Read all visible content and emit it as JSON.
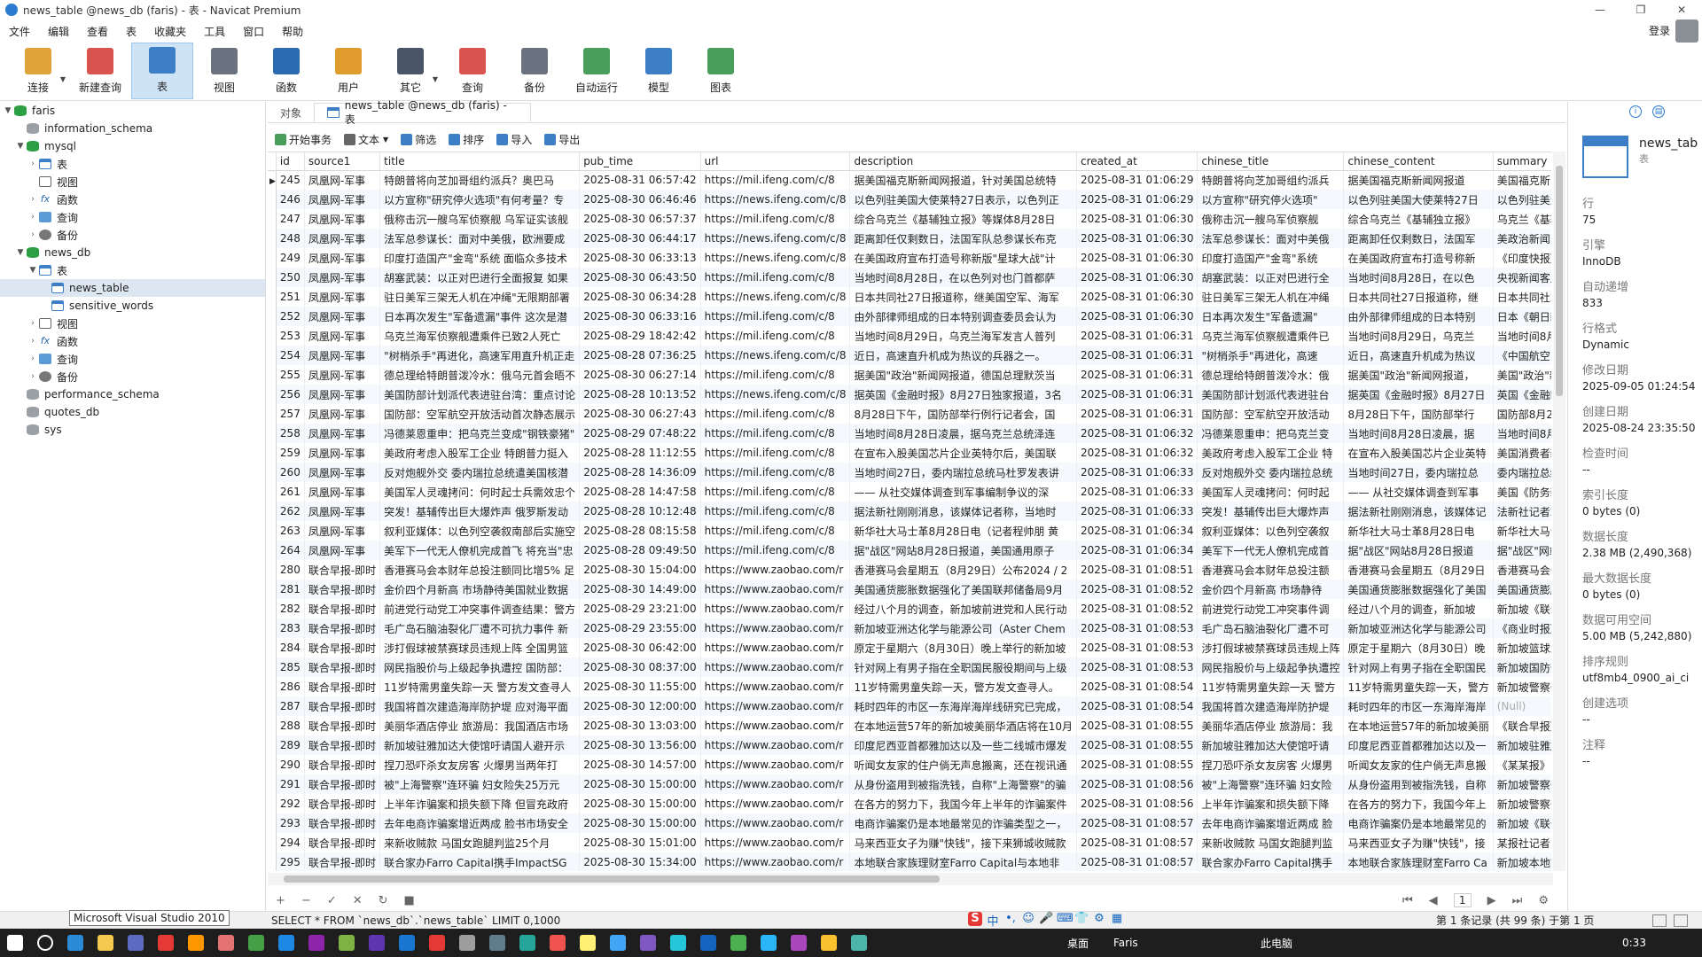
{
  "window": {
    "title": "news_table @news_db (faris) - 表 - Navicat Premium",
    "min": "—",
    "max": "❐",
    "close": "✕"
  },
  "menu": [
    "文件",
    "编辑",
    "查看",
    "表",
    "收藏夹",
    "工具",
    "窗口",
    "帮助"
  ],
  "login": "登录",
  "toolbar": [
    {
      "label": "连接",
      "color": "#e0a33a",
      "dd": true
    },
    {
      "label": "新建查询",
      "color": "#d9534f"
    },
    {
      "label": "表",
      "color": "#3c7fc6",
      "active": true
    },
    {
      "label": "视图",
      "color": "#6b7280"
    },
    {
      "label": "函数",
      "color": "#2b6cb0"
    },
    {
      "label": "用户",
      "color": "#e09b2d"
    },
    {
      "label": "其它",
      "color": "#4a5568",
      "dd": true
    },
    {
      "label": "查询",
      "color": "#d9534f"
    },
    {
      "label": "备份",
      "color": "#6b7280"
    },
    {
      "label": "自动运行",
      "color": "#4a9e5c"
    },
    {
      "label": "模型",
      "color": "#3c7fc6"
    },
    {
      "label": "图表",
      "color": "#4a9e5c"
    }
  ],
  "tree": [
    {
      "label": "faris",
      "level": 0,
      "caret": "▼",
      "icon": "db"
    },
    {
      "label": "information_schema",
      "level": 1,
      "caret": "",
      "icon": "dbg"
    },
    {
      "label": "mysql",
      "level": 1,
      "caret": "▼",
      "icon": "db"
    },
    {
      "label": "表",
      "level": 2,
      "caret": "›",
      "icon": "tbl"
    },
    {
      "label": "视图",
      "level": 2,
      "caret": "",
      "icon": "view"
    },
    {
      "label": "函数",
      "level": 2,
      "caret": "›",
      "icon": "fx"
    },
    {
      "label": "查询",
      "level": 2,
      "caret": "›",
      "icon": "q"
    },
    {
      "label": "备份",
      "level": 2,
      "caret": "›",
      "icon": "bk"
    },
    {
      "label": "news_db",
      "level": 1,
      "caret": "▼",
      "icon": "db"
    },
    {
      "label": "表",
      "level": 2,
      "caret": "▼",
      "icon": "tbl"
    },
    {
      "label": "news_table",
      "level": 3,
      "caret": "",
      "icon": "tbl",
      "sel": true
    },
    {
      "label": "sensitive_words",
      "level": 3,
      "caret": "",
      "icon": "tbl"
    },
    {
      "label": "视图",
      "level": 2,
      "caret": "›",
      "icon": "view"
    },
    {
      "label": "函数",
      "level": 2,
      "caret": "›",
      "icon": "fx"
    },
    {
      "label": "查询",
      "level": 2,
      "caret": "›",
      "icon": "q"
    },
    {
      "label": "备份",
      "level": 2,
      "caret": "›",
      "icon": "bk"
    },
    {
      "label": "performance_schema",
      "level": 1,
      "caret": "",
      "icon": "dbg"
    },
    {
      "label": "quotes_db",
      "level": 1,
      "caret": "",
      "icon": "dbg"
    },
    {
      "label": "sys",
      "level": 1,
      "caret": "",
      "icon": "dbg"
    }
  ],
  "tabs": {
    "objects": "对象",
    "active": "news_table @news_db (faris) - 表"
  },
  "subtoolbar": [
    {
      "label": "开始事务",
      "dd": false
    },
    {
      "label": "文本",
      "dd": true
    },
    {
      "label": "筛选",
      "dd": false
    },
    {
      "label": "排序",
      "dd": false
    },
    {
      "label": "导入",
      "dd": false
    },
    {
      "label": "导出",
      "dd": false
    }
  ],
  "columns": [
    "id",
    "source1",
    "title",
    "pub_time",
    "url",
    "description",
    "created_at",
    "chinese_title",
    "chinese_content",
    "summary"
  ],
  "rows": [
    [
      "245",
      "凤凰网-军事",
      "特朗普将向芝加哥组约派兵？奥巴马",
      "2025-08-31 06:57:42",
      "https://mil.ifeng.com/c/8",
      "据美国福克斯新闻网报道，针对美国总统特",
      "2025-08-31 01:06:29",
      "特朗普将向芝加哥组约派兵",
      "据美国福克斯新闻网报道",
      "美国福克斯"
    ],
    [
      "246",
      "凤凰网-军事",
      "以方宣称\"研究停火选项\"有何考量？专",
      "2025-08-30 06:46:46",
      "https://news.ifeng.com/c/8",
      "以色列驻美国大使莱特27日表示，以色列正",
      "2025-08-31 01:06:29",
      "以方宣称\"研究停火选项\"",
      "以色列驻美国大使莱特27日",
      "以色列驻美大"
    ],
    [
      "247",
      "凤凰网-军事",
      "俄称击沉一艘乌军侦察舰 乌军证实该舰",
      "2025-08-30 06:57:37",
      "https://mil.ifeng.com/c/8",
      "综合乌克兰《基辅独立报》等媒体8月28日",
      "2025-08-31 01:06:30",
      "俄称击沉一艘乌军侦察舰",
      "综合乌克兰《基辅独立报》",
      "乌克兰《基辅"
    ],
    [
      "248",
      "凤凰网-军事",
      "法军总参谋长：面对中美俄，欧洲要成",
      "2025-08-30 06:44:17",
      "https://news.ifeng.com/c/8",
      "距离卸任仅剩数日，法国军队总参谋长布克",
      "2025-08-31 01:06:30",
      "法军总参谋长：面对中美俄",
      "距离卸任仅剩数日，法国军",
      "美政治新闻"
    ],
    [
      "249",
      "凤凰网-军事",
      "印度打造国产\"金弯\"系统 面临众多技术",
      "2025-08-30 06:33:13",
      "https://news.ifeng.com/c/8",
      "在美国政府宣布打造号称新版\"星球大战\"计",
      "2025-08-31 01:06:30",
      "印度打造国产\"金弯\"系统",
      "在美国政府宣布打造号称新",
      "《印度快报》"
    ],
    [
      "250",
      "凤凰网-军事",
      "胡塞武装：以正对巴进行全面报复 如果",
      "2025-08-30 06:43:50",
      "https://mil.ifeng.com/c/8",
      "当地时间8月28日，在以色列对也门首都萨",
      "2025-08-31 01:06:30",
      "胡塞武装：以正对巴进行全",
      "当地时间8月28日，在以色",
      "央视新闻客户"
    ],
    [
      "251",
      "凤凰网-军事",
      "驻日美军三架无人机在冲绳\"无限期部署",
      "2025-08-30 06:34:28",
      "https://news.ifeng.com/c/8",
      "日本共同社27日报道称，继美国空军、海军",
      "2025-08-31 01:06:30",
      "驻日美军三架无人机在冲绳",
      "日本共同社27日报道称，继",
      "日本共同社27"
    ],
    [
      "252",
      "凤凰网-军事",
      "日本再次发生\"军备遗漏\"事件 这次是潜",
      "2025-08-30 06:33:16",
      "https://mil.ifeng.com/c/8",
      "由外部律师组成的日本特别调查委员会认为",
      "2025-08-31 01:06:30",
      "日本再次发生\"军备遗漏\"",
      "由外部律师组成的日本特别",
      "日本《朝日新"
    ],
    [
      "253",
      "凤凰网-军事",
      "乌克兰海军侦察舰遭乘件已致2人死亡",
      "2025-08-29 18:42:42",
      "https://mil.ifeng.com/c/8",
      "当地时间8月29日，乌克兰海军发言人普列",
      "2025-08-31 01:06:31",
      "乌克兰海军侦察舰遭乘件已",
      "当地时间8月29日，乌克兰",
      "当地时间8月2"
    ],
    [
      "254",
      "凤凰网-军事",
      "\"树梢杀手\"再进化，高速军用直升机正走",
      "2025-08-28 07:36:25",
      "https://news.ifeng.com/c/8",
      "近日，高速直升机成为热议的兵器之一。",
      "2025-08-31 01:06:31",
      "\"树梢杀手\"再进化，高速",
      "近日，高速直升机成为热议",
      "《中国航空"
    ],
    [
      "255",
      "凤凰网-军事",
      "德总理给特朗普泼冷水：俄乌元首会晤不",
      "2025-08-30 06:27:14",
      "https://mil.ifeng.com/c/8",
      "据美国\"政治\"新闻网报道，德国总理默茨当",
      "2025-08-31 01:06:31",
      "德总理给特朗普泼冷水：俄",
      "据美国\"政治\"新闻网报道，",
      "美国\"政治\"新"
    ],
    [
      "256",
      "凤凰网-军事",
      "美国防部计划派代表进驻台湾：重点讨论",
      "2025-08-28 10:13:52",
      "https://news.ifeng.com/c/8",
      "据英国《金融时报》8月27日独家报道，3名",
      "2025-08-31 01:06:31",
      "美国防部计划派代表进驻台",
      "据英国《金融时报》8月27日",
      "英国《金融时"
    ],
    [
      "257",
      "凤凰网-军事",
      "国防部：空军航空开放活动首次静态展示",
      "2025-08-30 06:27:43",
      "https://mil.ifeng.com/c/8",
      "8月28日下午，国防部举行例行记者会，国",
      "2025-08-31 01:06:31",
      "国防部：空军航空开放活动",
      "8月28日下午，国防部举行",
      "国防部8月2"
    ],
    [
      "258",
      "凤凰网-军事",
      "冯德莱恩重申：把乌克兰变成\"钢铁豪猪\"",
      "2025-08-29 07:48:22",
      "https://mil.ifeng.com/c/8",
      "当地时间8月28日凌晨，据乌克兰总统泽连",
      "2025-08-31 01:06:32",
      "冯德莱恩重申：把乌克兰变",
      "当地时间8月28日凌晨，据",
      "当地时间8月2"
    ],
    [
      "259",
      "凤凰网-军事",
      "美政府考虑入股军工企业 特朗普力挺入",
      "2025-08-28 11:12:55",
      "https://mil.ifeng.com/c/8",
      "在宣布入股美国芯片企业英特尔后，美国联",
      "2025-08-31 01:06:32",
      "美政府考虑入股军工企业 特",
      "在宣布入股美国芯片企业英特",
      "美国消费者新"
    ],
    [
      "260",
      "凤凰网-军事",
      "反对炮舰外交 委内瑞拉总统遣美国核潜",
      "2025-08-28 14:36:09",
      "https://mil.ifeng.com/c/8",
      "当地时间27日，委内瑞拉总统马杜罗发表讲",
      "2025-08-31 01:06:33",
      "反对炮舰外交 委内瑞拉总统",
      "当地时间27日，委内瑞拉总",
      "委内瑞拉总统"
    ],
    [
      "261",
      "凤凰网-军事",
      "美国军人灵魂拷问：何时起士兵需效忠个",
      "2025-08-28 14:47:58",
      "https://mil.ifeng.com/c/8",
      "—— 从社交媒体调查到军事编制争议的深",
      "2025-08-31 01:06:33",
      "美国军人灵魂拷问：何时起",
      "—— 从社交媒体调查到军事",
      "美国《防务新"
    ],
    [
      "262",
      "凤凰网-军事",
      "突发！基辅传出巨大爆炸声 俄罗斯发动",
      "2025-08-28 10:12:48",
      "https://mil.ifeng.com/c/8",
      "据法新社刚刚消息，该媒体记者称，当地时",
      "2025-08-31 01:06:33",
      "突发！基辅传出巨大爆炸声",
      "据法新社刚刚消息，该媒体记",
      "法新社记者28"
    ],
    [
      "263",
      "凤凰网-军事",
      "叙利亚媒体：以色列空袭叙南部后实施空",
      "2025-08-28 08:15:58",
      "https://mil.ifeng.com/c/8",
      "新华社大马士革8月28日电（记者程帅朋 黄",
      "2025-08-31 01:06:34",
      "叙利亚媒体：以色列空袭叙",
      "新华社大马士革8月28日电",
      "新华社大马士"
    ],
    [
      "264",
      "凤凰网-军事",
      "美军下一代无人僚机完成首飞 将充当\"忠",
      "2025-08-28 09:49:50",
      "https://mil.ifeng.com/c/8",
      "据\"战区\"网站8月28日报道，美国通用原子",
      "2025-08-31 01:06:34",
      "美军下一代无人僚机完成首",
      "据\"战区\"网站8月28日报道",
      "据\"战区\"网站"
    ],
    [
      "280",
      "联合早报-即时",
      "香港赛马会本财年总投注额同比增5% 足",
      "2025-08-30 15:04:00",
      "https://www.zaobao.com/r",
      "香港赛马会星期五（8月29日）公布2024 / 2",
      "2025-08-31 01:08:51",
      "香港赛马会本财年总投注额",
      "香港赛马会星期五（8月29日",
      "香港赛马会于"
    ],
    [
      "281",
      "联合早报-即时",
      "金价四个月新高 市场静待美国就业数据",
      "2025-08-30 14:49:00",
      "https://www.zaobao.com/r",
      "美国通货膨胀数据强化了美国联邦储备局9月",
      "2025-08-31 01:08:52",
      "金价四个月新高 市场静待",
      "美国通货膨胀数据强化了美国",
      "美国通货膨胀"
    ],
    [
      "282",
      "联合早报-即时",
      "前进党行动党工冲突事件调查结果：警方",
      "2025-08-29 23:21:00",
      "https://www.zaobao.com/r",
      "经过八个月的调查，新加坡前进党和人民行动",
      "2025-08-31 01:08:52",
      "前进党行动党工冲突事件调",
      "经过八个月的调查，新加坡",
      "新加坡《联合"
    ],
    [
      "283",
      "联合早报-即时",
      "毛广岛石脑油裂化厂遭不可抗力事件 新",
      "2025-08-29 23:55:00",
      "https://www.zaobao.com/r",
      "新加坡亚洲达化学与能源公司（Aster Chem",
      "2025-08-31 01:08:53",
      "毛广岛石脑油裂化厂遭不可",
      "新加坡亚洲达化学与能源公司",
      "《商业时报》"
    ],
    [
      "284",
      "联合早报-即时",
      "涉打假球被禁赛球员违规上阵 全国男篮",
      "2025-08-30 06:42:00",
      "https://www.zaobao.com/r",
      "原定于星期六（8月30日）晚上举行的新加坡",
      "2025-08-31 01:08:53",
      "涉打假球被禁赛球员违规上阵",
      "原定于星期六（8月30日）晚",
      "新加坡篮球总"
    ],
    [
      "285",
      "联合早报-即时",
      "网民指股价与上级起争执遭控 国防部：",
      "2025-08-30 08:37:00",
      "https://www.zaobao.com/r",
      "针对网上有男子指在全职国民服役期间与上级",
      "2025-08-31 01:08:53",
      "网民指股价与上级起争执遭控",
      "针对网上有男子指在全职国民",
      "新加坡国防部"
    ],
    [
      "286",
      "联合早报-即时",
      "11岁特需男童失踪一天 警方发文查寻人",
      "2025-08-30 11:55:00",
      "https://www.zaobao.com/r",
      "11岁特需男童失踪一天，警方发文查寻人。",
      "2025-08-31 01:08:54",
      "11岁特需男童失踪一天 警方",
      "11岁特需男童失踪一天，警方",
      "新加坡警察部"
    ],
    [
      "287",
      "联合早报-即时",
      "我国将首次建造海岸防护堤 应对海平面",
      "2025-08-30 12:00:00",
      "https://www.zaobao.com/r",
      "耗时四年的市区一东海岸海岸线研究已完成，",
      "2025-08-31 01:08:54",
      "我国将首次建造海岸防护堤",
      "耗时四年的市区一东海岸海岸",
      "(Null)"
    ],
    [
      "288",
      "联合早报-即时",
      "美丽华酒店停业 旅游局：我国酒店市场",
      "2025-08-30 13:03:00",
      "https://www.zaobao.com/r",
      "在本地运营57年的新加坡美丽华酒店将在10月",
      "2025-08-31 01:08:55",
      "美丽华酒店停业 旅游局：我",
      "在本地运营57年的新加坡美丽",
      "《联合早报》"
    ],
    [
      "289",
      "联合早报-即时",
      "新加坡驻雅加达大使馆吁请国人避开示",
      "2025-08-30 13:56:00",
      "https://www.zaobao.com/r",
      "印度尼西亚首都雅加达以及一些二线城市爆发",
      "2025-08-31 01:08:55",
      "新加坡驻雅加达大使馆吁请",
      "印度尼西亚首都雅加达以及一",
      "新加坡驻雅加"
    ],
    [
      "290",
      "联合早报-即时",
      "捏刀恐吓杀女友房客 火爆男当两年打",
      "2025-08-30 14:57:00",
      "https://www.zaobao.com/r",
      "听闻女友家的住户倘无声息搬离，还在视讯通",
      "2025-08-31 01:08:55",
      "捏刀恐吓杀女友房客 火爆男",
      "听闻女友家的住户倘无声息搬",
      "《某某报》"
    ],
    [
      "291",
      "联合早报-即时",
      "被\"上海警察\"连环骗 妇女险失25万元",
      "2025-08-30 15:00:00",
      "https://www.zaobao.com/r",
      "从身份盗用到被指洗钱，自称\"上海警察\"的骗",
      "2025-08-31 01:08:56",
      "被\"上海警察\"连环骗 妇女险",
      "从身份盗用到被指洗钱，自称",
      "新加坡警察部"
    ],
    [
      "292",
      "联合早报-即时",
      "上半年诈骗案和损失额下降 但冒充政府",
      "2025-08-30 15:00:00",
      "https://www.zaobao.com/r",
      "在各方的努力下，我国今年上半年的诈骗案件",
      "2025-08-31 01:08:56",
      "上半年诈骗案和损失额下降",
      "在各方的努力下，我国今年上",
      "新加坡警察部"
    ],
    [
      "293",
      "联合早报-即时",
      "去年电商诈骗案增近两成 脸书市场安全",
      "2025-08-30 15:00:00",
      "https://www.zaobao.com/r",
      "电商诈骗案仍是本地最常见的诈骗类型之一，",
      "2025-08-31 01:08:57",
      "去年电商诈骗案增近两成 脸",
      "电商诈骗案仍是本地最常见的",
      "新加坡《联合"
    ],
    [
      "294",
      "联合早报-即时",
      "来新收贼款 马国女跑腿判监25个月",
      "2025-08-30 15:01:00",
      "https://www.zaobao.com/r",
      "马来西亚女子为赚\"快钱\"，接下来狮城收贼款",
      "2025-08-31 01:08:57",
      "来新收贼款 马国女跑腿判监",
      "马来西亚女子为赚\"快钱\"，接",
      "某报社记者"
    ],
    [
      "295",
      "联合早报-即时",
      "联合家办Farro Capital携手ImpactSG",
      "2025-08-30 15:34:00",
      "https://www.zaobao.com/r",
      "本地联合家族理财室Farro Capital与本地非",
      "2025-08-31 01:08:57",
      "联合家办Farro Capital携手",
      "本地联合家族理财室Farro Ca",
      "新加坡本地家"
    ]
  ],
  "nav": {
    "page": "1",
    "add": "+",
    "remove": "−",
    "check": "✓",
    "cancel": "✕",
    "refresh": "↻",
    "stop": "■",
    "first": "⏮",
    "prev": "◀",
    "next": "▶",
    "last": "⏭",
    "gear": "⚙"
  },
  "info": {
    "name": "news_tab",
    "type": "表",
    "fields": [
      {
        "label": "行",
        "value": "75"
      },
      {
        "label": "引擎",
        "value": "InnoDB"
      },
      {
        "label": "自动递增",
        "value": "833"
      },
      {
        "label": "行格式",
        "value": "Dynamic"
      },
      {
        "label": "修改日期",
        "value": "2025-09-05 01:24:54"
      },
      {
        "label": "创建日期",
        "value": "2025-08-24 23:35:50"
      },
      {
        "label": "检查时间",
        "value": "--"
      },
      {
        "label": "索引长度",
        "value": "0 bytes (0)"
      },
      {
        "label": "数据长度",
        "value": "2.38 MB (2,490,368)"
      },
      {
        "label": "最大数据长度",
        "value": "0 bytes (0)"
      },
      {
        "label": "数据可用空间",
        "value": "5.00 MB (5,242,880)"
      },
      {
        "label": "排序规则",
        "value": "utf8mb4_0900_ai_ci"
      },
      {
        "label": "创建选项",
        "value": "--"
      },
      {
        "label": "注释",
        "value": "--"
      }
    ]
  },
  "status": {
    "tooltip": "Microsoft Visual Studio 2010",
    "sql": "SELECT * FROM `news_db`.`news_table` LIMIT 0,1000",
    "records": "第 1 条记录 (共 99 条) 于第 1 页"
  },
  "ime": [
    "S",
    "中",
    "•,",
    "☺",
    "🎤",
    "⌨",
    "👕",
    "⚙",
    "▦"
  ],
  "taskbar": {
    "desktop": "桌面",
    "user": "Faris",
    "pc": "此电脑",
    "time": "0:33"
  },
  "colors": {
    "accent": "#3c7fc6",
    "selected": "#cfe3f7",
    "taskbar": "#1e1e1e"
  }
}
